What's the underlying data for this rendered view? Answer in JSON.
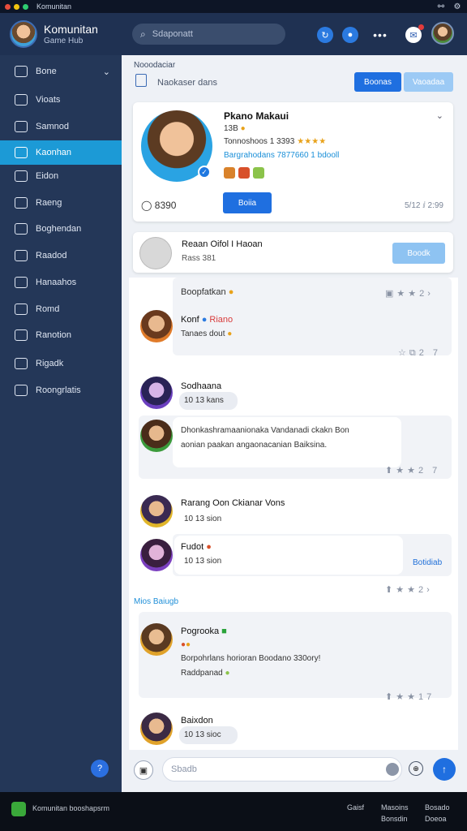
{
  "window": {
    "title": "Komunitan"
  },
  "header": {
    "app_name": "Komunitan",
    "app_subtitle": "Game Hub",
    "search_placeholder": "Sdaponatt"
  },
  "sidebar": {
    "items": [
      {
        "label": "Bone",
        "icon": "compass-icon"
      },
      {
        "label": "Vioats",
        "icon": "grid-icon"
      },
      {
        "label": "Samnod",
        "icon": "bell-icon"
      },
      {
        "label": "Kaonhan",
        "icon": "feed-icon",
        "active": true
      },
      {
        "label": "Eidon",
        "icon": "image-icon"
      },
      {
        "label": "Raeng",
        "icon": "list-icon"
      },
      {
        "label": "Boghendan",
        "icon": "home-icon"
      },
      {
        "label": "Raadod",
        "icon": "user-icon"
      },
      {
        "label": "Hanaahos",
        "icon": "chat-icon"
      },
      {
        "label": "Romd",
        "icon": "store-icon"
      },
      {
        "label": "Ranotion",
        "icon": "news-icon"
      },
      {
        "label": "Rigadk",
        "icon": "settings-icon"
      },
      {
        "label": "Roongrlatis",
        "icon": "globe-icon"
      }
    ]
  },
  "main": {
    "breadcrumb": "Nooodaciar",
    "toolbar_label": "Naokaser dans",
    "btn_primary": "Boonas",
    "btn_secondary": "Vaoadaa",
    "profile": {
      "name": "Pkano Makaui",
      "sub": "13B",
      "stats": "Tonnoshoos 1 3393",
      "stars": "★★★★",
      "link": "Bargrahodans 7877660 1 bdooll",
      "button": "Boiia",
      "score": "8390",
      "meta": "5/12 ⅈ 2:99"
    },
    "follow": {
      "name": "Reaan Oifol I Haoan",
      "sub": "Rass 381",
      "button": "Boodk"
    },
    "posts": [
      {
        "label": "Boopfatkan",
        "counter": "2"
      },
      {
        "name": "Konf",
        "tag": "Riano",
        "text": "Tanaes dout",
        "counter": "2 7"
      },
      {
        "name": "Sodhaana",
        "time": "10 13 kans"
      },
      {
        "text_line1": "Dhonkashramaanionaka Vandanadi ckakn Bon",
        "text_line2": "aonian paakan angaonacanian Baiksina.",
        "counter": "2 7"
      },
      {
        "name": "Rarang Oon Ckianar Vons",
        "time": "10 13 sion"
      },
      {
        "name": "Fudot",
        "time": "10 13 sion",
        "reply": "Botidiab",
        "counter": "2"
      },
      {
        "section": "Mios Baiugb"
      },
      {
        "name": "Pogrooka",
        "line1_prefix": "Borpohrlans horioran Boodano",
        "line1_hl": "330ory!",
        "line2": "Raddpanad",
        "counter": "17"
      },
      {
        "name": "Baixdon",
        "time": "10 13 sioc"
      }
    ],
    "composer_placeholder": "Sbadb"
  },
  "footer": {
    "brand": "Komunitan booshapsrm",
    "col1": [
      "Gaisf",
      ""
    ],
    "col2": [
      "Masoins",
      "Bonsdin"
    ],
    "col3": [
      "Bosado",
      "Doeoa"
    ]
  },
  "colors": {
    "accent": "#1f6fe0",
    "active_nav": "#1c9ad6",
    "sidebar_bg": "#243758"
  }
}
